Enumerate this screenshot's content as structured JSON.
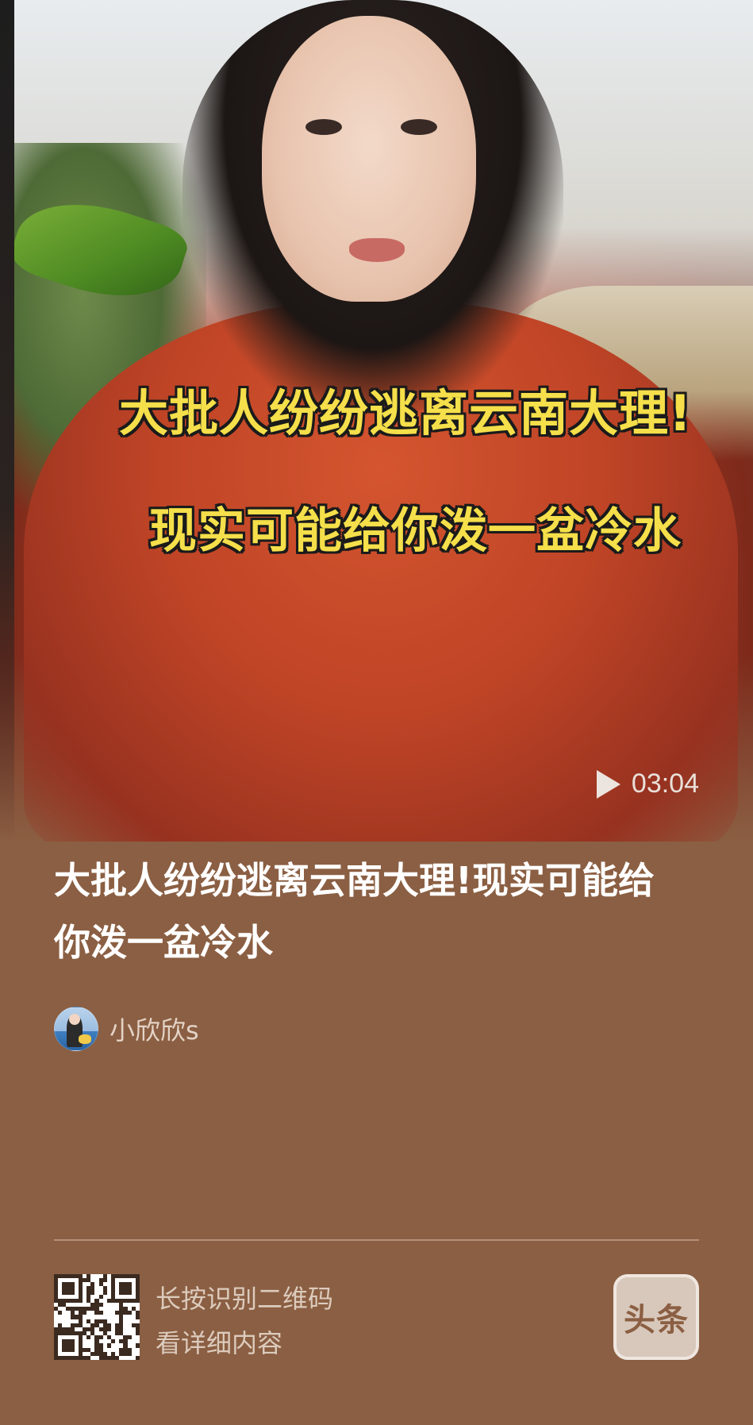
{
  "video": {
    "overlay_line_1": "大批人纷纷逃离云南大理!",
    "overlay_line_2": "现实可能给你泼一盆冷水",
    "duration": "03:04"
  },
  "article": {
    "title": "大批人纷纷逃离云南大理!现实可能给你泼一盆冷水",
    "author_name": "小欣欣s"
  },
  "footer": {
    "qr_line_1": "长按识别二维码",
    "qr_line_2": "看详细内容",
    "brand_logo_text": "头条"
  },
  "colors": {
    "background": "#8b5f43",
    "overlay_text": "#f5df4a",
    "title_text": "#ffffff",
    "muted_text": "#dccbbd"
  },
  "icons": {
    "play": "play-icon",
    "qr": "qr-code-icon",
    "brand": "toutiao-logo"
  }
}
